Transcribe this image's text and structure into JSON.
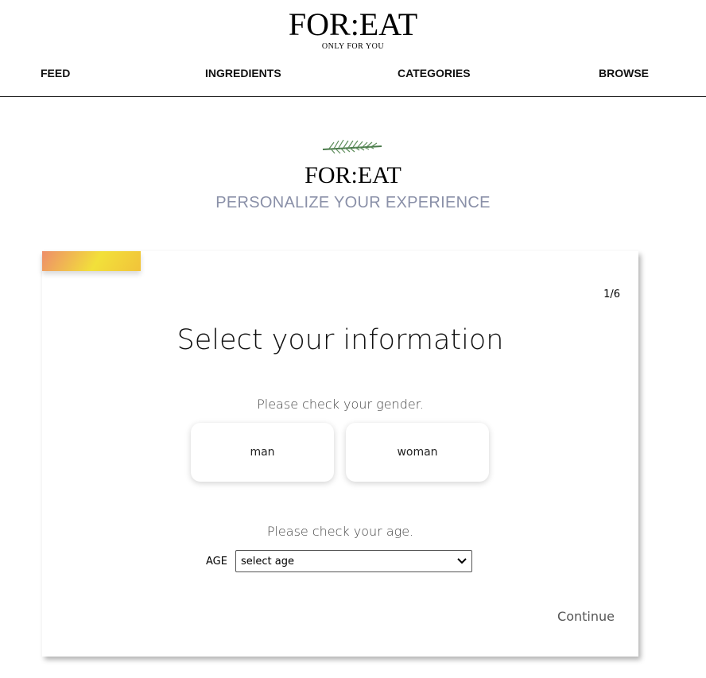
{
  "header": {
    "logo": "FOR:EAT",
    "tagline": "ONLY FOR YOU"
  },
  "nav": [
    {
      "label": "FEED"
    },
    {
      "label": "INGREDIENTS"
    },
    {
      "label": "CATEGORIES"
    },
    {
      "label": "BROWSE"
    }
  ],
  "hero": {
    "logo": "FOR:EAT",
    "subtitle": "PERSONALIZE YOUR EXPERIENCE"
  },
  "card": {
    "step": "1/6",
    "title": "Select your information",
    "gender_question": "Please check your gender.",
    "genders": [
      "man",
      "woman"
    ],
    "age_question": "Please check your age.",
    "age_label": "AGE",
    "age_select": "select age",
    "continue": "Continue",
    "accent_gradient": [
      "#ee8e6a",
      "#f2e03a",
      "#f1c33a"
    ]
  }
}
